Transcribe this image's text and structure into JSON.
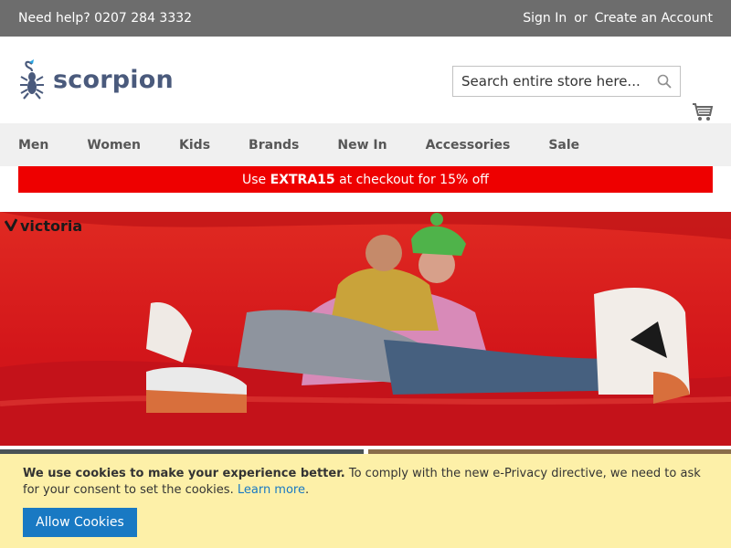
{
  "topbar": {
    "help_text": "Need help? 0207 284 3332",
    "sign_in": "Sign In",
    "or": "or",
    "create_account": "Create an Account"
  },
  "header": {
    "logo_text": "scorpion",
    "search_placeholder": "Search entire store here...",
    "search_icon": "magnifier-icon",
    "cart_icon": "shopping-cart-icon"
  },
  "nav": {
    "items": [
      "Men",
      "Women",
      "Kids",
      "Brands",
      "New In",
      "Accessories",
      "Sale"
    ]
  },
  "promo": {
    "prefix": "Use ",
    "code": "EXTRA15",
    "suffix": " at checkout for 15% off"
  },
  "hero": {
    "brand": "victoria"
  },
  "cookie": {
    "bold": "We use cookies to make your experience better.",
    "text": " To comply with the new e-Privacy directive, we need to ask for your consent to set the cookies. ",
    "link": "Learn more",
    "end": ".",
    "button": "Allow Cookies"
  },
  "colors": {
    "topbar": "#6d6d6d",
    "promo": "#ee0000",
    "cookie_bg": "#fdf0a8",
    "cookie_button": "#1979c3",
    "logo": "#4a5a7c"
  }
}
